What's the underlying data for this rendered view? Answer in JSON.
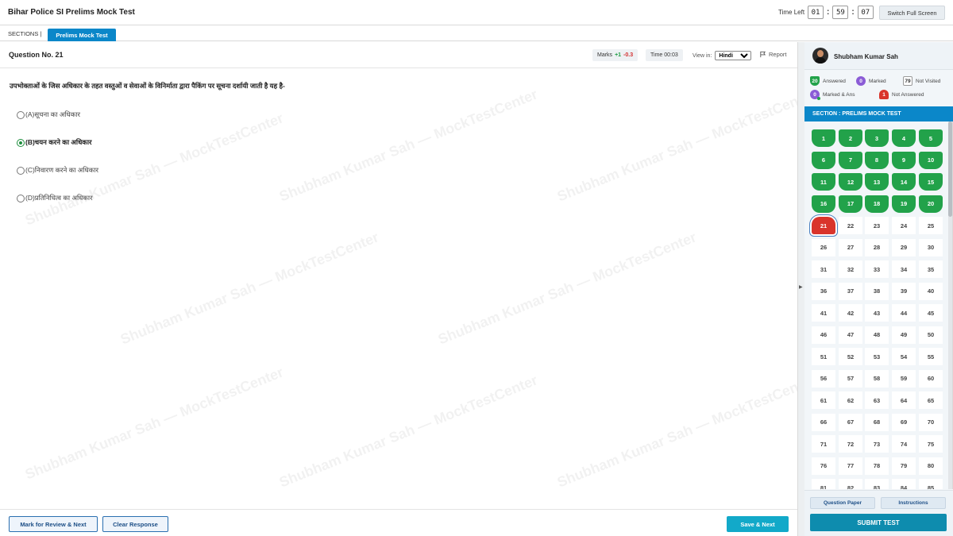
{
  "header": {
    "title": "Bihar Police SI Prelims Mock Test",
    "time_left_label": "Time Left",
    "timer": {
      "hours": "01",
      "minutes": "59",
      "seconds": "07"
    },
    "fullscreen_label": "Switch Full Screen"
  },
  "sections": {
    "label": "SECTIONS |",
    "active_tab": "Prelims Mock Test"
  },
  "question": {
    "number_label": "Question No. 21",
    "marks_label": "Marks",
    "marks_positive": "+1",
    "marks_negative": "-0.3",
    "time_label": "Time 00:03",
    "view_in_label": "View in:",
    "language": "Hindi",
    "report_label": "Report",
    "text": "उपभोक्ताओं के जिस अधिकार के तहत वस्तुओं व सेवाओं के विनिर्माता द्वारा पैकिंग पर सूचना दर्शायी जाती है यह है-",
    "options": [
      {
        "label": "(A)सूचना का अधिकार",
        "selected": false
      },
      {
        "label": "(B)चयन करने का अधिकार",
        "selected": true
      },
      {
        "label": "(C)निवारण करने का अधिकार",
        "selected": false
      },
      {
        "label": "(D)प्रतिनिधित्व का अधिकार",
        "selected": false
      }
    ]
  },
  "watermark_text": "Shubham Kumar Sah — MockTestCenter",
  "footer": {
    "mark_review_label": "Mark for Review & Next",
    "clear_label": "Clear Response",
    "save_next_label": "Save & Next"
  },
  "panel": {
    "user_name": "Shubham Kumar Sah",
    "legend": {
      "answered_count": "20",
      "answered_label": "Answered",
      "marked_count": "0",
      "marked_label": "Marked",
      "not_visited_count": "79",
      "not_visited_label": "Not Visited",
      "marked_ans_count": "0",
      "marked_ans_label": "Marked & Ans",
      "not_answered_count": "1",
      "not_answered_label": "Not Answered"
    },
    "section_title": "SECTION : PRELIMS MOCK TEST",
    "question_states": {
      "answered": [
        1,
        2,
        3,
        4,
        5,
        6,
        7,
        8,
        9,
        10,
        11,
        12,
        13,
        14,
        15,
        16,
        17,
        18,
        19,
        20
      ],
      "not_answered": [
        21
      ],
      "visible_last": 85
    },
    "question_paper_label": "Question Paper",
    "instructions_label": "Instructions",
    "submit_label": "SUBMIT TEST"
  },
  "colors": {
    "accent": "#0b87c9",
    "answered": "#22a24a",
    "not_answered": "#d9342b",
    "marked": "#8b5cd6",
    "save": "#12a9c9"
  }
}
